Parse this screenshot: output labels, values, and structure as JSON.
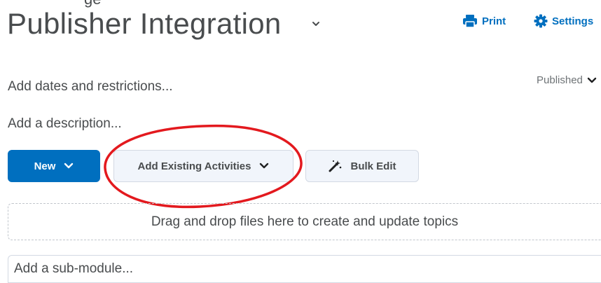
{
  "header": {
    "top_clip_text": "ge",
    "title": "Publisher Integration",
    "print_label": "Print",
    "settings_label": "Settings"
  },
  "module": {
    "dates_label": "Add dates and restrictions...",
    "status_label": "Published",
    "description_label": "Add a description..."
  },
  "actions": {
    "new_label": "New",
    "add_existing_label": "Add Existing Activities",
    "bulk_edit_label": "Bulk Edit"
  },
  "dropzone": {
    "text": "Drag and drop files here to create and update topics"
  },
  "submodule": {
    "placeholder": "Add a sub-module..."
  },
  "colors": {
    "primary": "#006fbf",
    "annotation": "#e3191e",
    "text": "#494c4e"
  },
  "icons": {
    "print": "printer-icon",
    "settings": "gear-icon",
    "bulk_edit": "magic-wand-icon",
    "chevron": "chevron-down-icon"
  }
}
